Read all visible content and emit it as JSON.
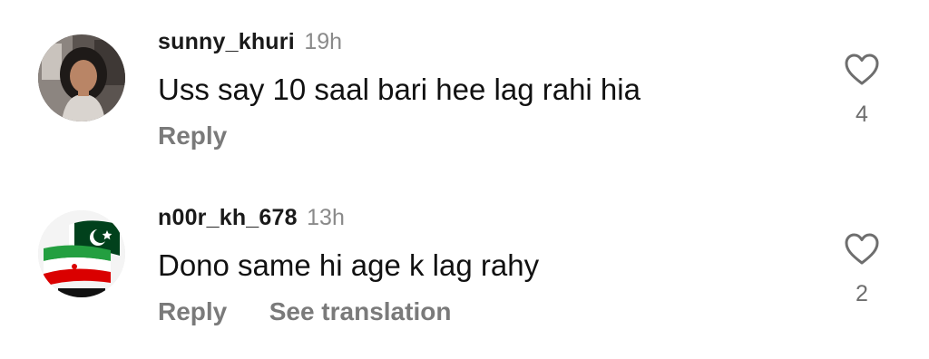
{
  "comments": [
    {
      "username": "sunny_khuri",
      "time": "19h",
      "text": "Uss say 10 saal bari hee lag rahi hia",
      "reply_label": "Reply",
      "like_count": "4",
      "like_icon": "heart-outline-icon"
    },
    {
      "username": "n00r_kh_678",
      "time": "13h",
      "text": "Dono same hi age k lag rahy",
      "reply_label": "Reply",
      "translate_label": "See translation",
      "like_count": "2",
      "like_icon": "heart-outline-icon"
    }
  ],
  "colors": {
    "text": "#111111",
    "muted": "#8a8a8a",
    "action": "#7a7a7a",
    "pakistan_green": "#01411C",
    "iran_green": "#239F40",
    "iran_red": "#DA0000"
  }
}
